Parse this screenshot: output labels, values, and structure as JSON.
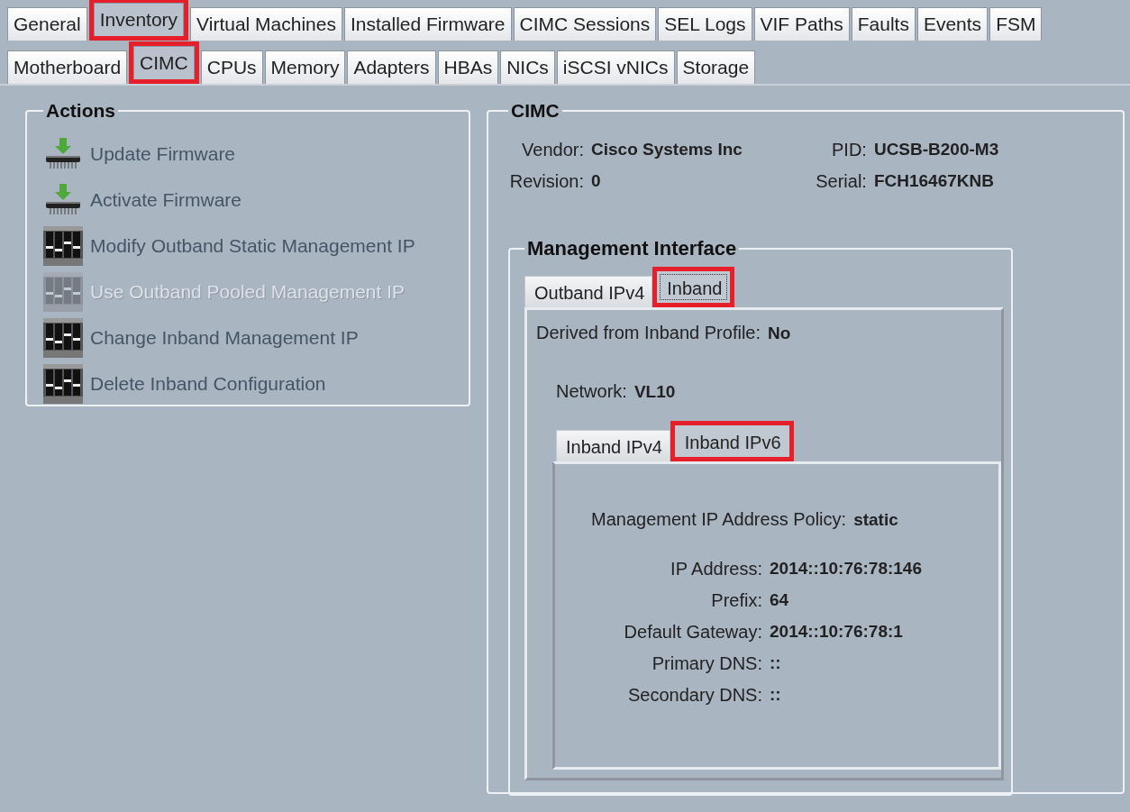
{
  "main_tabs": [
    {
      "label": "General",
      "selected": false,
      "highlighted": false
    },
    {
      "label": "Inventory",
      "selected": true,
      "highlighted": true
    },
    {
      "label": "Virtual Machines",
      "selected": false,
      "highlighted": false
    },
    {
      "label": "Installed Firmware",
      "selected": false,
      "highlighted": false
    },
    {
      "label": "CIMC Sessions",
      "selected": false,
      "highlighted": false
    },
    {
      "label": "SEL Logs",
      "selected": false,
      "highlighted": false
    },
    {
      "label": "VIF Paths",
      "selected": false,
      "highlighted": false
    },
    {
      "label": "Faults",
      "selected": false,
      "highlighted": false
    },
    {
      "label": "Events",
      "selected": false,
      "highlighted": false
    },
    {
      "label": "FSM",
      "selected": false,
      "highlighted": false
    }
  ],
  "sub_tabs": [
    {
      "label": "Motherboard",
      "selected": false,
      "highlighted": false
    },
    {
      "label": "CIMC",
      "selected": true,
      "highlighted": true
    },
    {
      "label": "CPUs",
      "selected": false,
      "highlighted": false
    },
    {
      "label": "Memory",
      "selected": false,
      "highlighted": false
    },
    {
      "label": "Adapters",
      "selected": false,
      "highlighted": false
    },
    {
      "label": "HBAs",
      "selected": false,
      "highlighted": false
    },
    {
      "label": "NICs",
      "selected": false,
      "highlighted": false
    },
    {
      "label": "iSCSI vNICs",
      "selected": false,
      "highlighted": false
    },
    {
      "label": "Storage",
      "selected": false,
      "highlighted": false
    }
  ],
  "actions": {
    "title": "Actions",
    "items": [
      {
        "label": "Update Firmware",
        "kind": "firmware",
        "disabled": false
      },
      {
        "label": "Activate Firmware",
        "kind": "firmware",
        "disabled": false
      },
      {
        "label": "Modify Outband Static Management IP",
        "kind": "config",
        "disabled": false
      },
      {
        "label": "Use Outband Pooled Management IP",
        "kind": "config",
        "disabled": true
      },
      {
        "label": "Change Inband Management IP",
        "kind": "config",
        "disabled": false
      },
      {
        "label": "Delete Inband Configuration",
        "kind": "config",
        "disabled": false
      }
    ]
  },
  "cimc": {
    "title": "CIMC",
    "fields": [
      {
        "label": "Vendor:",
        "value": "Cisco Systems Inc"
      },
      {
        "label": "PID:",
        "value": "UCSB-B200-M3"
      },
      {
        "label": "Revision:",
        "value": "0"
      },
      {
        "label": "Serial:",
        "value": "FCH16467KNB"
      }
    ],
    "management_interface": {
      "title": "Management Interface",
      "tabs": [
        {
          "label": "Outband IPv4",
          "selected": false,
          "highlighted": false
        },
        {
          "label": "Inband",
          "selected": true,
          "highlighted": true
        }
      ],
      "derived": {
        "label": "Derived from Inband Profile:",
        "value": "No"
      },
      "network": {
        "label": "Network:",
        "value": "VL10"
      },
      "ip_tabs": [
        {
          "label": "Inband IPv4",
          "selected": false,
          "highlighted": false
        },
        {
          "label": "Inband IPv6",
          "selected": true,
          "highlighted": true
        }
      ],
      "policy": {
        "label": "Management IP Address Policy:",
        "value": "static"
      },
      "fields": [
        {
          "label": "IP Address:",
          "value": "2014::10:76:78:146"
        },
        {
          "label": "Prefix:",
          "value": "64"
        },
        {
          "label": "Default Gateway:",
          "value": "2014::10:76:78:1"
        },
        {
          "label": "Primary DNS:",
          "value": "::"
        },
        {
          "label": "Secondary DNS:",
          "value": "::"
        }
      ]
    }
  }
}
